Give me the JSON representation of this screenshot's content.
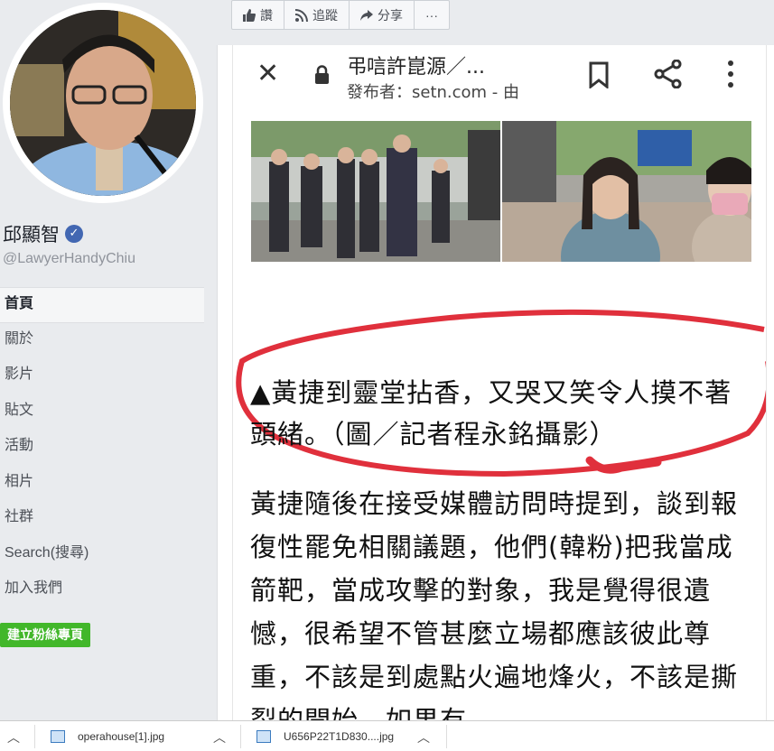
{
  "sidebar": {
    "page_name": "邱顯智",
    "username": "@LawyerHandyChiu",
    "nav": [
      {
        "label": "首頁",
        "active": true
      },
      {
        "label": "關於"
      },
      {
        "label": "影片"
      },
      {
        "label": "貼文"
      },
      {
        "label": "活動"
      },
      {
        "label": "相片"
      },
      {
        "label": "社群"
      },
      {
        "label": "Search(搜尋)"
      },
      {
        "label": "加入我們"
      }
    ],
    "create_page_label": "建立粉絲專頁"
  },
  "actions": {
    "like": "讚",
    "follow": "追蹤",
    "share": "分享",
    "more": "···"
  },
  "post": {
    "url_title": "弔唁許崑源／...",
    "url_sub": "發布者：setn.com - 由",
    "caption": "▲黃捷到靈堂拈香，又哭又笑令人摸不著頭緒。（圖／記者程永銘攝影）",
    "body": "黃捷隨後在接受媒體訪問時提到，談到報復性罷免相關議題，他們(韓粉)把我當成箭靶，當成攻擊的對象，我是覺得很遺憾，很希望不管甚麼立場都應該彼此尊重，不該是到處點火遍地烽火，不該是撕裂的開始，如果有"
  },
  "downloads": [
    {
      "name": "operahouse[1].jpg"
    },
    {
      "name": "U656P22T1D830....jpg"
    }
  ],
  "colors": {
    "accent": "#4267b2",
    "create_button": "#42b72a",
    "annotation": "#e0303c"
  }
}
